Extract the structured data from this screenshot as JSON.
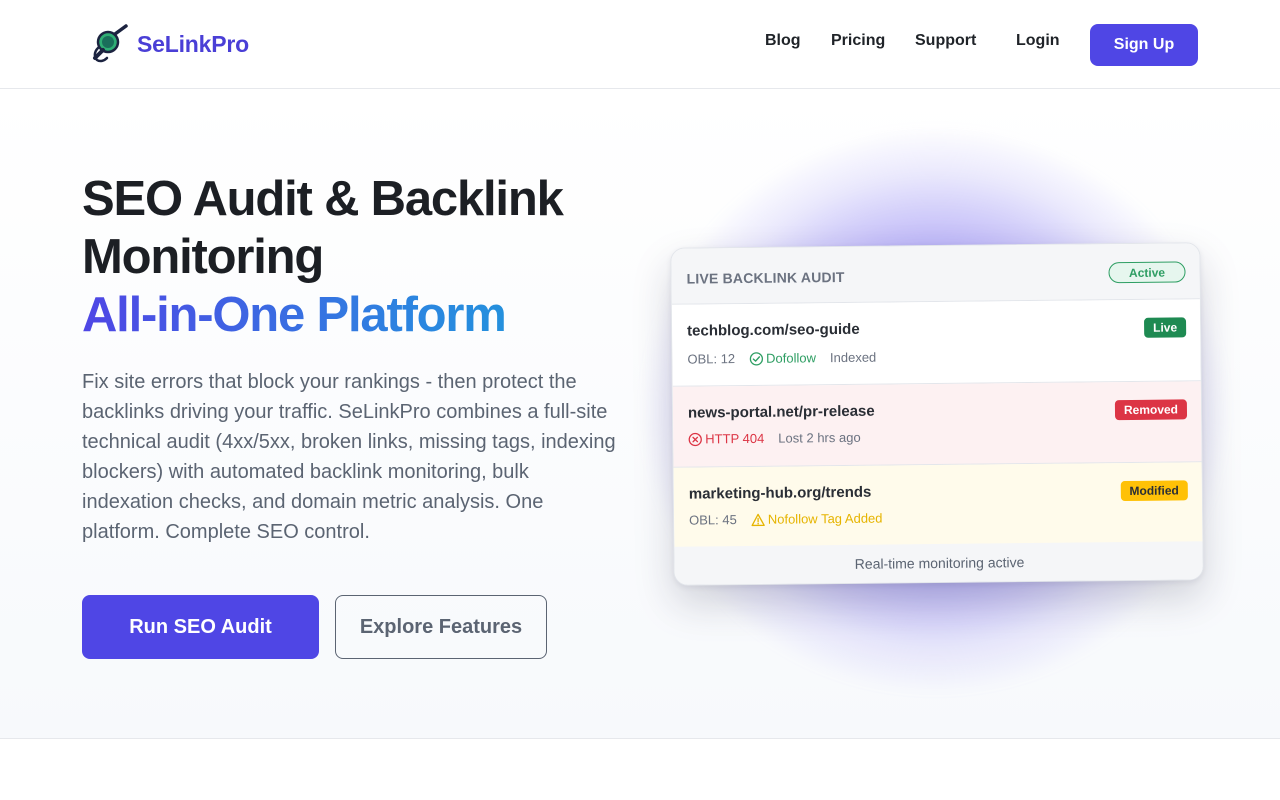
{
  "header": {
    "brand_name": "SeLinkPro",
    "nav": [
      "Blog",
      "Pricing",
      "Support",
      "Login"
    ],
    "signup_label": "Sign Up"
  },
  "hero": {
    "title_line1": "SEO Audit & Backlink",
    "title_line2": "Monitoring",
    "title_line3": "All-in-One Platform",
    "description": "Fix site errors that block your rankings - then protect the backlinks driving your traffic. SeLinkPro combines a full-site technical audit (4xx/5xx, broken links, missing tags, indexing blockers) with automated backlink monitoring, bulk indexation checks, and domain metric analysis. One platform. Complete SEO control.",
    "primary_cta": "Run SEO Audit",
    "secondary_cta": "Explore Features"
  },
  "audit_card": {
    "title": "LIVE BACKLINK AUDIT",
    "status": "Active",
    "rows": [
      {
        "url": "techblog.com/seo-guide",
        "badge": "Live",
        "obl": "OBL: 12",
        "tag": "Dofollow",
        "extra": "Indexed"
      },
      {
        "url": "news-portal.net/pr-release",
        "badge": "Removed",
        "tag": "HTTP 404",
        "extra": "Lost 2 hrs ago"
      },
      {
        "url": "marketing-hub.org/trends",
        "badge": "Modified",
        "obl": "OBL: 45",
        "tag": "Nofollow Tag Added"
      }
    ],
    "footer": "Real-time monitoring active"
  },
  "colors": {
    "brand": "#4f46e5",
    "success": "#1e8a52",
    "danger": "#dc3545",
    "warning": "#ffc107"
  },
  "icons": {
    "logo": "magnifier-link-logo",
    "dofollow": "check-circle-icon",
    "removed": "x-circle-icon",
    "modified": "warning-triangle-icon"
  }
}
